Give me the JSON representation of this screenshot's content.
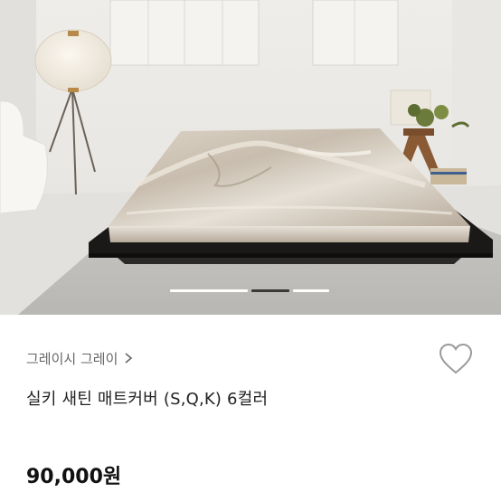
{
  "product": {
    "seller_label": "그레이시 그레이",
    "title": "실키 새틴 매트커버 (S,Q,K) 6컬러",
    "price": "90,000원"
  },
  "gallery": {
    "slide_count": 3,
    "active_slide": 2
  },
  "icons": {
    "seller_link": "chevron-right-icon",
    "like": "heart-outline-icon"
  },
  "colors": {
    "background": "#ffffff",
    "text_primary": "#222222",
    "text_secondary": "#666666",
    "icon": "#9a9a9a"
  }
}
